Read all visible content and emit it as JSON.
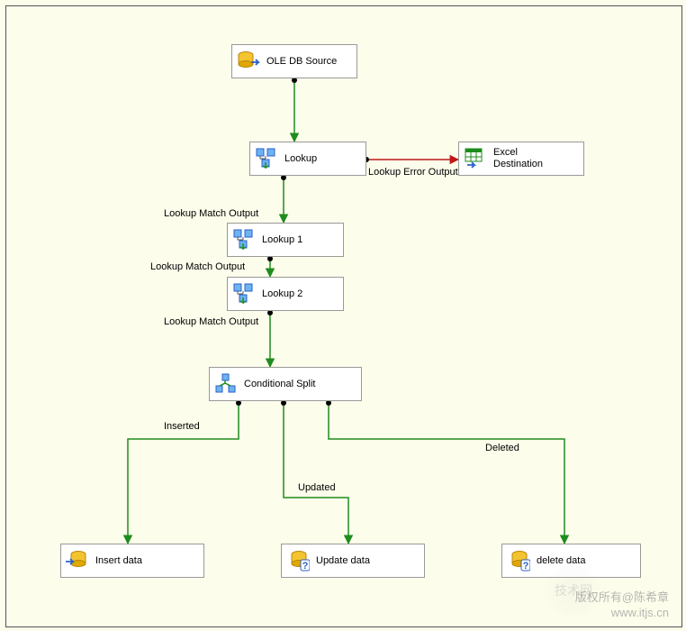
{
  "nodes": {
    "oledb_source": {
      "label": "OLE DB Source"
    },
    "lookup": {
      "label": "Lookup"
    },
    "excel_dest": {
      "label": "Excel\nDestination"
    },
    "lookup1": {
      "label": "Lookup 1"
    },
    "lookup2": {
      "label": "Lookup 2"
    },
    "cond_split": {
      "label": "Conditional Split"
    },
    "insert_data": {
      "label": "Insert data"
    },
    "update_data": {
      "label": "Update data"
    },
    "delete_data": {
      "label": "delete data"
    }
  },
  "edges": {
    "lookup_error": "Lookup Error Output",
    "lookup_match_1": "Lookup Match Output",
    "lookup_match_2": "Lookup Match Output",
    "lookup_match_3": "Lookup Match Output",
    "inserted": "Inserted",
    "updated": "Updated",
    "deleted": "Deleted"
  },
  "watermarks": {
    "line1": "版权所有@陈希章",
    "line2": "www.itjs.cn",
    "logo": "技术网"
  },
  "chart_data": {
    "type": "flowchart",
    "title": "SSIS Data Flow",
    "nodes": [
      {
        "id": "oledb_source",
        "label": "OLE DB Source",
        "type": "source"
      },
      {
        "id": "lookup",
        "label": "Lookup",
        "type": "transform"
      },
      {
        "id": "excel_dest",
        "label": "Excel Destination",
        "type": "destination"
      },
      {
        "id": "lookup1",
        "label": "Lookup 1",
        "type": "transform"
      },
      {
        "id": "lookup2",
        "label": "Lookup 2",
        "type": "transform"
      },
      {
        "id": "cond_split",
        "label": "Conditional Split",
        "type": "transform"
      },
      {
        "id": "insert_data",
        "label": "Insert data",
        "type": "destination"
      },
      {
        "id": "update_data",
        "label": "Update data",
        "type": "destination"
      },
      {
        "id": "delete_data",
        "label": "delete data",
        "type": "destination"
      }
    ],
    "edges": [
      {
        "from": "oledb_source",
        "to": "lookup",
        "label": "",
        "status": "success"
      },
      {
        "from": "lookup",
        "to": "excel_dest",
        "label": "Lookup Error Output",
        "status": "error"
      },
      {
        "from": "lookup",
        "to": "lookup1",
        "label": "Lookup Match Output",
        "status": "success"
      },
      {
        "from": "lookup1",
        "to": "lookup2",
        "label": "Lookup Match Output",
        "status": "success"
      },
      {
        "from": "lookup2",
        "to": "cond_split",
        "label": "Lookup Match Output",
        "status": "success"
      },
      {
        "from": "cond_split",
        "to": "insert_data",
        "label": "Inserted",
        "status": "success"
      },
      {
        "from": "cond_split",
        "to": "update_data",
        "label": "Updated",
        "status": "success"
      },
      {
        "from": "cond_split",
        "to": "delete_data",
        "label": "Deleted",
        "status": "success"
      }
    ]
  }
}
